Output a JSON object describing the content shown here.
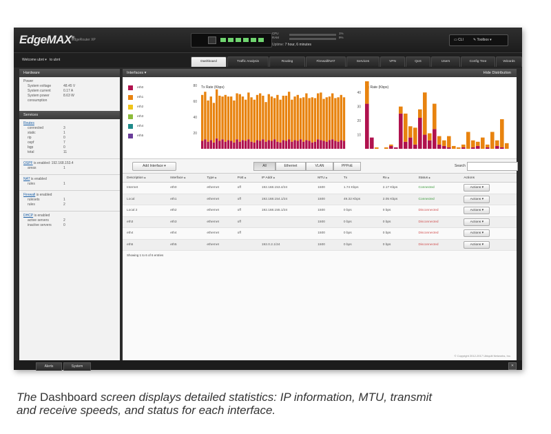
{
  "header": {
    "logo": "EdgeMAX",
    "product": "EdgeRouter XP",
    "cpu_label": "CPU",
    "ram_label": "RAM",
    "cpu_pct": "1%",
    "ram_pct": "9%",
    "uptime_label": "Uptime:",
    "uptime_value": "7 hour, 6 minutes",
    "cli_label": "CLI",
    "toolbox_label": "Toolbox"
  },
  "nav": {
    "welcome": "Welcome ubnt",
    "to": "to ubnt",
    "tabs": [
      "Dashboard",
      "Traffic Analysis",
      "Routing",
      "Firewall/NAT",
      "Services",
      "VPN",
      "QoS",
      "Users",
      "Config Tree",
      "Wizards"
    ]
  },
  "sidebar": {
    "hardware_title": "Hardware",
    "power_title": "Power",
    "power_rows": [
      {
        "k": "System voltage",
        "v": "48.45 V"
      },
      {
        "k": "System current",
        "v": "0.17 A"
      },
      {
        "k": "System power",
        "v": "8.63 W"
      },
      {
        "k": "consumption",
        "v": ""
      }
    ],
    "services_title": "Services",
    "routes_link": "Routes",
    "routes_rows": [
      {
        "k": "connected",
        "v": "3"
      },
      {
        "k": "static",
        "v": "1"
      },
      {
        "k": "rip",
        "v": "0"
      },
      {
        "k": "ospf",
        "v": "7"
      },
      {
        "k": "bgp",
        "v": "0"
      },
      {
        "k": "total",
        "v": "11"
      }
    ],
    "ospf_link": "OSPF",
    "ospf_text": "is enabled: 192.168.153.4",
    "ospf_rows": [
      {
        "k": "areas",
        "v": "1"
      }
    ],
    "nat_link": "NAT",
    "nat_text": "is enabled",
    "nat_rows": [
      {
        "k": "rules",
        "v": "1"
      }
    ],
    "firewall_link": "Firewall",
    "firewall_text": "is enabled",
    "firewall_rows": [
      {
        "k": "rulesets",
        "v": "1"
      },
      {
        "k": "rules",
        "v": "2"
      }
    ],
    "dhcp_link": "DHCP",
    "dhcp_text": "is enabled",
    "dhcp_rows": [
      {
        "k": "active servers",
        "v": "2"
      },
      {
        "k": "inactive servers",
        "v": "0"
      }
    ]
  },
  "interfaces": {
    "title": "Interfaces",
    "hide_dist": "Hide Distribution",
    "legend": [
      {
        "name": "eth0",
        "color": "#b0124e"
      },
      {
        "name": "eth1",
        "color": "#e8830f"
      },
      {
        "name": "eth2",
        "color": "#f0c419"
      },
      {
        "name": "eth3",
        "color": "#8dbb3a"
      },
      {
        "name": "eth4",
        "color": "#1f8a8a"
      },
      {
        "name": "eth5",
        "color": "#6a3d9a"
      }
    ]
  },
  "chart_data": [
    {
      "type": "bar",
      "title": "Tx Rate (Kbps)",
      "ylim": [
        0,
        80
      ],
      "yticks": [
        20,
        40,
        60,
        80
      ],
      "series": [
        {
          "name": "eth0",
          "values": [
            10,
            12,
            9,
            11,
            8,
            13,
            10,
            12,
            9,
            11,
            10,
            8,
            12,
            9,
            11,
            10,
            12,
            9,
            8,
            11,
            10,
            12,
            9,
            11,
            10,
            12,
            9,
            8,
            11,
            10,
            12,
            9,
            11,
            10,
            12,
            9,
            11,
            10,
            8,
            9,
            12,
            11,
            10,
            9,
            11,
            12,
            10,
            9,
            11,
            10
          ]
        },
        {
          "name": "eth1",
          "values": [
            58,
            60,
            52,
            55,
            50,
            62,
            57,
            54,
            59,
            55,
            56,
            53,
            58,
            60,
            55,
            52,
            59,
            56,
            54,
            57,
            60,
            55,
            50,
            58,
            56,
            52,
            59,
            54,
            56,
            57,
            60,
            53,
            55,
            58,
            52,
            56,
            59,
            54,
            57,
            55,
            58,
            60,
            53,
            56,
            55,
            58,
            54,
            56,
            57,
            55
          ]
        }
      ]
    },
    {
      "type": "bar",
      "title": "Rx Rate (Kbps)",
      "ylim": [
        0,
        45
      ],
      "yticks": [
        10,
        20,
        30,
        40
      ],
      "series": [
        {
          "name": "eth0",
          "values": [
            32,
            8,
            0,
            0,
            0,
            2,
            1,
            25,
            5,
            8,
            3,
            22,
            10,
            6,
            14,
            3,
            2,
            1,
            0,
            0,
            1,
            0,
            1,
            2,
            0,
            1,
            0,
            2,
            1,
            0
          ]
        },
        {
          "name": "eth1",
          "values": [
            40,
            0,
            1,
            0,
            1,
            1,
            0,
            5,
            20,
            8,
            12,
            6,
            30,
            5,
            18,
            6,
            4,
            8,
            2,
            1,
            2,
            12,
            5,
            3,
            8,
            2,
            12,
            4,
            20,
            4
          ]
        }
      ]
    }
  ],
  "toolbar": {
    "add_interface": "Add Interface",
    "filters": [
      "All",
      "Ethernet",
      "VLAN",
      "PPPoE"
    ],
    "search_label": "Search"
  },
  "table": {
    "headers": [
      "Description",
      "Interface",
      "Type",
      "PoE",
      "IP Addr",
      "MTU",
      "Tx",
      "Rx",
      "Status",
      "Actions"
    ],
    "rows": [
      {
        "desc": "Internet",
        "iface": "eth0",
        "type": "ethernet",
        "poe": "off",
        "ip": "192.168.153.4/24",
        "mtu": "1500",
        "tx": "1.74 Kbps",
        "rx": "2.17 Kbps",
        "status": "Connected",
        "connected": true
      },
      {
        "desc": "Local",
        "iface": "eth1",
        "type": "ethernet",
        "poe": "off",
        "ip": "192.168.154.1/24",
        "mtu": "1500",
        "tx": "49.32 Kbps",
        "rx": "2.05 Kbps",
        "status": "Connected",
        "connected": true
      },
      {
        "desc": "Local 2",
        "iface": "eth2",
        "type": "ethernet",
        "poe": "off",
        "ip": "192.168.155.1/24",
        "mtu": "1500",
        "tx": "0 bps",
        "rx": "0 bps",
        "status": "Disconnected",
        "connected": false
      },
      {
        "desc": "eth3",
        "iface": "eth3",
        "type": "ethernet",
        "poe": "off",
        "ip": "",
        "mtu": "1500",
        "tx": "0 bps",
        "rx": "0 bps",
        "status": "Disconnected",
        "connected": false
      },
      {
        "desc": "eth4",
        "iface": "eth4",
        "type": "ethernet",
        "poe": "off",
        "ip": "",
        "mtu": "1500",
        "tx": "0 bps",
        "rx": "0 bps",
        "status": "Disconnected",
        "connected": false
      },
      {
        "desc": "eth5",
        "iface": "eth5",
        "type": "ethernet",
        "poe": "",
        "ip": "192.0.2.1/24",
        "mtu": "1500",
        "tx": "0 bps",
        "rx": "0 bps",
        "status": "Disconnected",
        "connected": false
      }
    ],
    "action_label": "Actions",
    "showing": "Showing 1 to 6 of 6 entries"
  },
  "footer": {
    "copyright": "© Copyright 2012-2017 Ubiquiti Networks, Inc.",
    "tabs": [
      "Alerts",
      "System"
    ]
  },
  "caption": {
    "line1_a": "The ",
    "line1_b": "Dashboard",
    "line1_c": " screen displays detailed statistics: IP information, MTU, transmit",
    "line2": "and receive speeds, and status for each interface."
  }
}
